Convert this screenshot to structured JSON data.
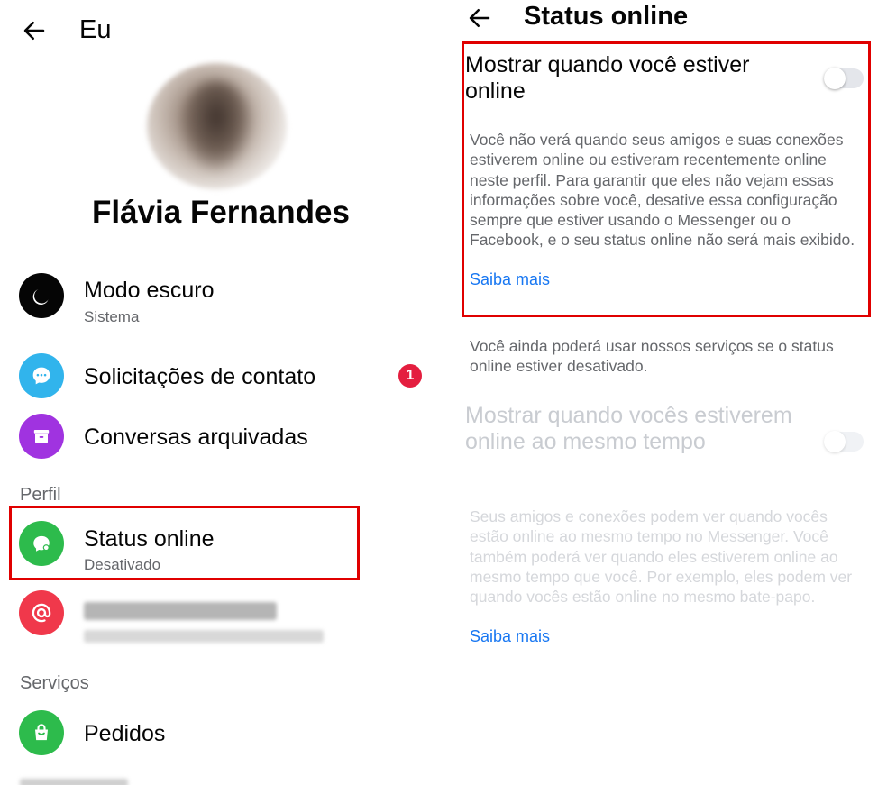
{
  "left": {
    "title": "Eu",
    "profile_name": "Flávia Fernandes",
    "items": [
      {
        "label": "Modo escuro",
        "sub": "Sistema",
        "icon": "moon-icon"
      },
      {
        "label": "Solicitações de contato",
        "badge": "1",
        "icon": "chat-bubble-icon"
      },
      {
        "label": "Conversas arquivadas",
        "icon": "archive-box-icon"
      }
    ],
    "section_profile": "Perfil",
    "status_item": {
      "label": "Status online",
      "sub": "Desativado",
      "icon": "online-status-icon"
    },
    "username_item": {
      "icon": "at-sign-icon"
    },
    "section_services": "Serviços",
    "orders_item": {
      "label": "Pedidos",
      "icon": "shopping-bag-icon"
    }
  },
  "right": {
    "title": "Status online",
    "setting1": {
      "title": "Mostrar quando você estiver online",
      "enabled": false,
      "description": "Você não verá quando seus amigos e suas conexões estiverem online ou estiveram recentemente online neste perfil. Para garantir que eles não vejam essas informações sobre você, desative essa configuração sempre que estiver usando o Messenger ou o Facebook, e o seu status online não será mais exibido.",
      "learn_more": "Saiba mais"
    },
    "note": "Você ainda poderá usar nossos serviços se o status online estiver desativado.",
    "setting2": {
      "title": "Mostrar quando vocês estiverem online ao mesmo tempo",
      "enabled": false,
      "description": "Seus amigos e conexões podem ver quando vocês estão online ao mesmo tempo no Messenger. Você também poderá ver quando eles estiverem online ao mesmo tempo que você. Por exemplo, eles podem ver quando vocês estão online no mesmo bate-papo.",
      "learn_more": "Saiba mais"
    }
  },
  "colors": {
    "highlight": "#e00000",
    "link": "#1877f2",
    "badge": "#e41e3f",
    "secondary_text": "#65676b"
  }
}
